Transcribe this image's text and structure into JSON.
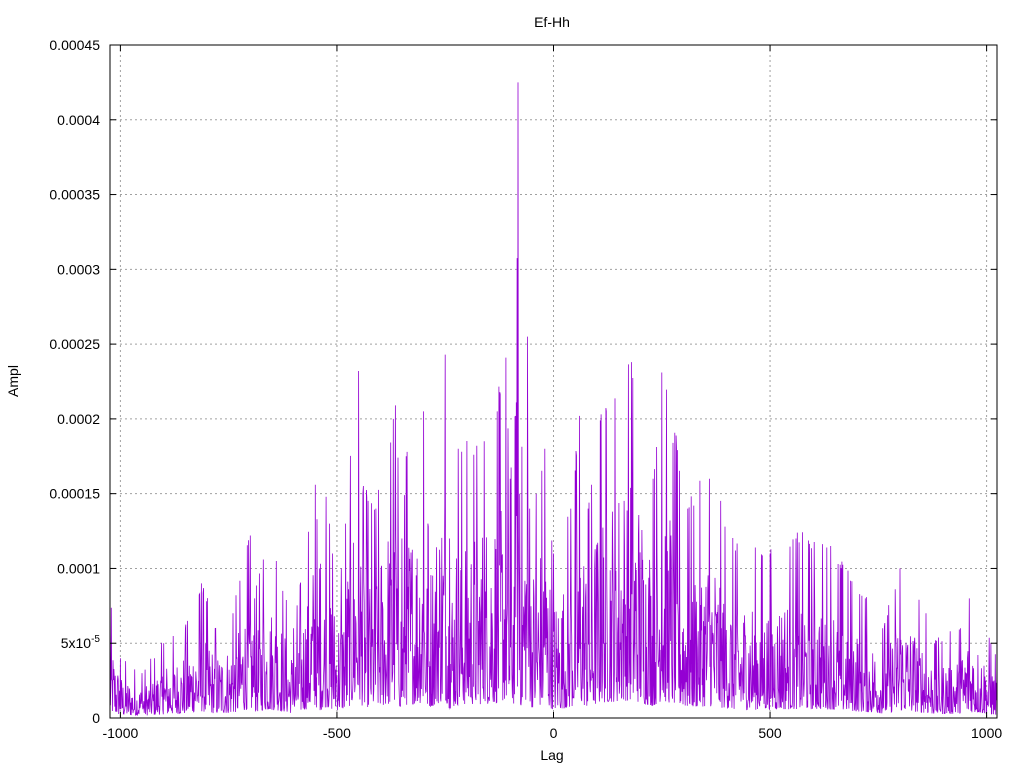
{
  "chart_data": {
    "type": "line",
    "title": "Ef-Hh",
    "xlabel": "Lag",
    "ylabel": "Ampl",
    "xlim": [
      -1024,
      1024
    ],
    "ylim": [
      0,
      0.00045
    ],
    "grid": true,
    "x_ticks": [
      -1000,
      -500,
      0,
      500,
      1000
    ],
    "x_tick_labels": [
      "-1000",
      "-500",
      "0",
      "500",
      "1000"
    ],
    "y_ticks": [
      0,
      5e-05,
      0.0001,
      0.00015,
      0.0002,
      0.00025,
      0.0003,
      0.00035,
      0.0004,
      0.00045
    ],
    "y_tick_labels": [
      "0",
      "5x10^-5",
      "0.0001",
      "0.00015",
      "0.0002",
      "0.00025",
      "0.0003",
      "0.00035",
      "0.0004",
      "0.00045"
    ],
    "color": "#9400d3",
    "series": [
      {
        "x": [
          -1024,
          -1000,
          -950,
          -900,
          -850,
          -813,
          -780,
          -740,
          -700,
          -690,
          -670,
          -640,
          -600,
          -550,
          -540,
          -525,
          -510,
          -490,
          -480,
          -450,
          -440,
          -410,
          -370,
          -365,
          -350,
          -340,
          -300,
          -290,
          -250,
          -240,
          -220,
          -160,
          -130,
          -110,
          -100,
          -86,
          -82,
          -78,
          -60,
          -55,
          -40,
          -20,
          0,
          40,
          60,
          80,
          110,
          180,
          230,
          250,
          310,
          360,
          420,
          500,
          560,
          640,
          720,
          760,
          800,
          860,
          880,
          940,
          960,
          1010,
          1024
        ],
        "y": [
          7.5e-05,
          4e-05,
          3e-05,
          5e-05,
          6e-05,
          9e-05,
          6e-05,
          7e-05,
          0.000122,
          8e-05,
          0.000106,
          0.000105,
          6e-05,
          0.000156,
          0.0001,
          0.000148,
          0.00011,
          0.0001,
          0.00013,
          0.000232,
          0.00015,
          0.00014,
          0.0002,
          0.000209,
          0.00012,
          0.000175,
          0.000205,
          0.00013,
          0.000243,
          0.00012,
          0.00018,
          0.000185,
          0.000205,
          0.000241,
          0.00016,
          0.000211,
          0.000425,
          0.00015,
          0.000255,
          0.00014,
          0.00015,
          0.00018,
          0.00011,
          0.00014,
          0.000202,
          0.00014,
          0.000203,
          0.000238,
          0.00016,
          0.000231,
          0.00014,
          0.00016,
          0.000112,
          0.00011,
          0.00012,
          0.000115,
          8e-05,
          6e-05,
          0.0001,
          7e-05,
          5e-05,
          6e-05,
          8e-05,
          5e-05,
          4e-05
        ]
      }
    ]
  }
}
